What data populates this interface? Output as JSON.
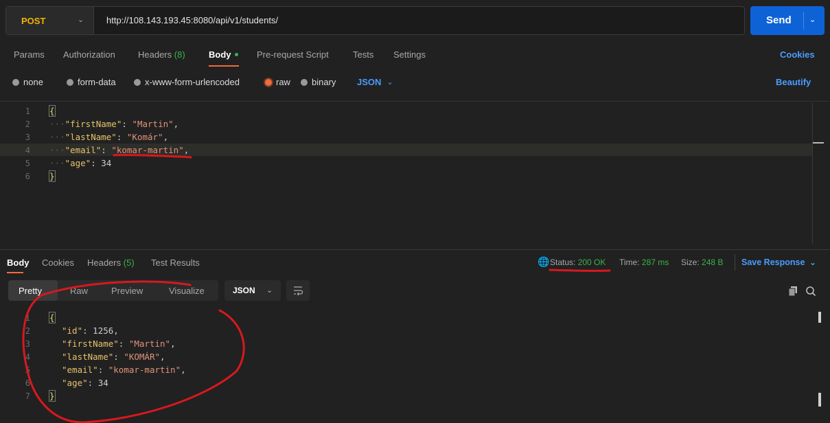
{
  "request": {
    "method": "POST",
    "url": "http://108.143.193.45:8080/api/v1/students/",
    "send_label": "Send"
  },
  "request_tabs": {
    "params": "Params",
    "authorization": "Authorization",
    "headers": "Headers",
    "headers_count": "(8)",
    "body": "Body",
    "pre_request": "Pre-request Script",
    "tests": "Tests",
    "settings": "Settings",
    "cookies": "Cookies"
  },
  "body_options": {
    "none": "none",
    "form_data": "form-data",
    "urlencoded": "x-www-form-urlencoded",
    "raw": "raw",
    "binary": "binary",
    "format": "JSON",
    "beautify": "Beautify"
  },
  "request_body": {
    "line_numbers": [
      "1",
      "2",
      "3",
      "4",
      "5",
      "6"
    ],
    "open": "{",
    "close": "}",
    "fields": [
      {
        "key": "\"firstName\"",
        "value": "\"Martin\"",
        "sep": ","
      },
      {
        "key": "\"lastName\"",
        "value": "\"Komár\"",
        "sep": ","
      },
      {
        "key": "\"email\"",
        "value": "\"komar-martin\"",
        "sep": ","
      },
      {
        "key": "\"age\"",
        "value": "34",
        "sep": ""
      }
    ]
  },
  "response_tabs": {
    "body": "Body",
    "cookies": "Cookies",
    "headers": "Headers",
    "headers_count": "(5)",
    "test_results": "Test Results"
  },
  "response_status": {
    "status_label": "Status:",
    "status_value": "200 OK",
    "time_label": "Time:",
    "time_value": "287 ms",
    "size_label": "Size:",
    "size_value": "248 B",
    "save_response": "Save Response"
  },
  "response_view": {
    "pretty": "Pretty",
    "raw": "Raw",
    "preview": "Preview",
    "visualize": "Visualize",
    "format": "JSON"
  },
  "response_body": {
    "line_numbers": [
      "1",
      "2",
      "3",
      "4",
      "5",
      "6",
      "7"
    ],
    "open": "{",
    "close": "}",
    "fields": [
      {
        "key": "\"id\"",
        "value": "1256",
        "sep": ","
      },
      {
        "key": "\"firstName\"",
        "value": "\"Martin\"",
        "sep": ","
      },
      {
        "key": "\"lastName\"",
        "value": "\"KOMÁR\"",
        "sep": ","
      },
      {
        "key": "\"email\"",
        "value": "\"komar-martin\"",
        "sep": ","
      },
      {
        "key": "\"age\"",
        "value": "34",
        "sep": ""
      }
    ]
  },
  "colors": {
    "accent": "#f26b3a",
    "send": "#0d63d6",
    "method": "#f5b400",
    "ok": "#39b54a",
    "annotation": "#d9181e"
  },
  "icons": {
    "globe": "globe-icon",
    "copy": "copy-icon",
    "search": "search-icon",
    "wrap": "wrap-lines-icon"
  }
}
